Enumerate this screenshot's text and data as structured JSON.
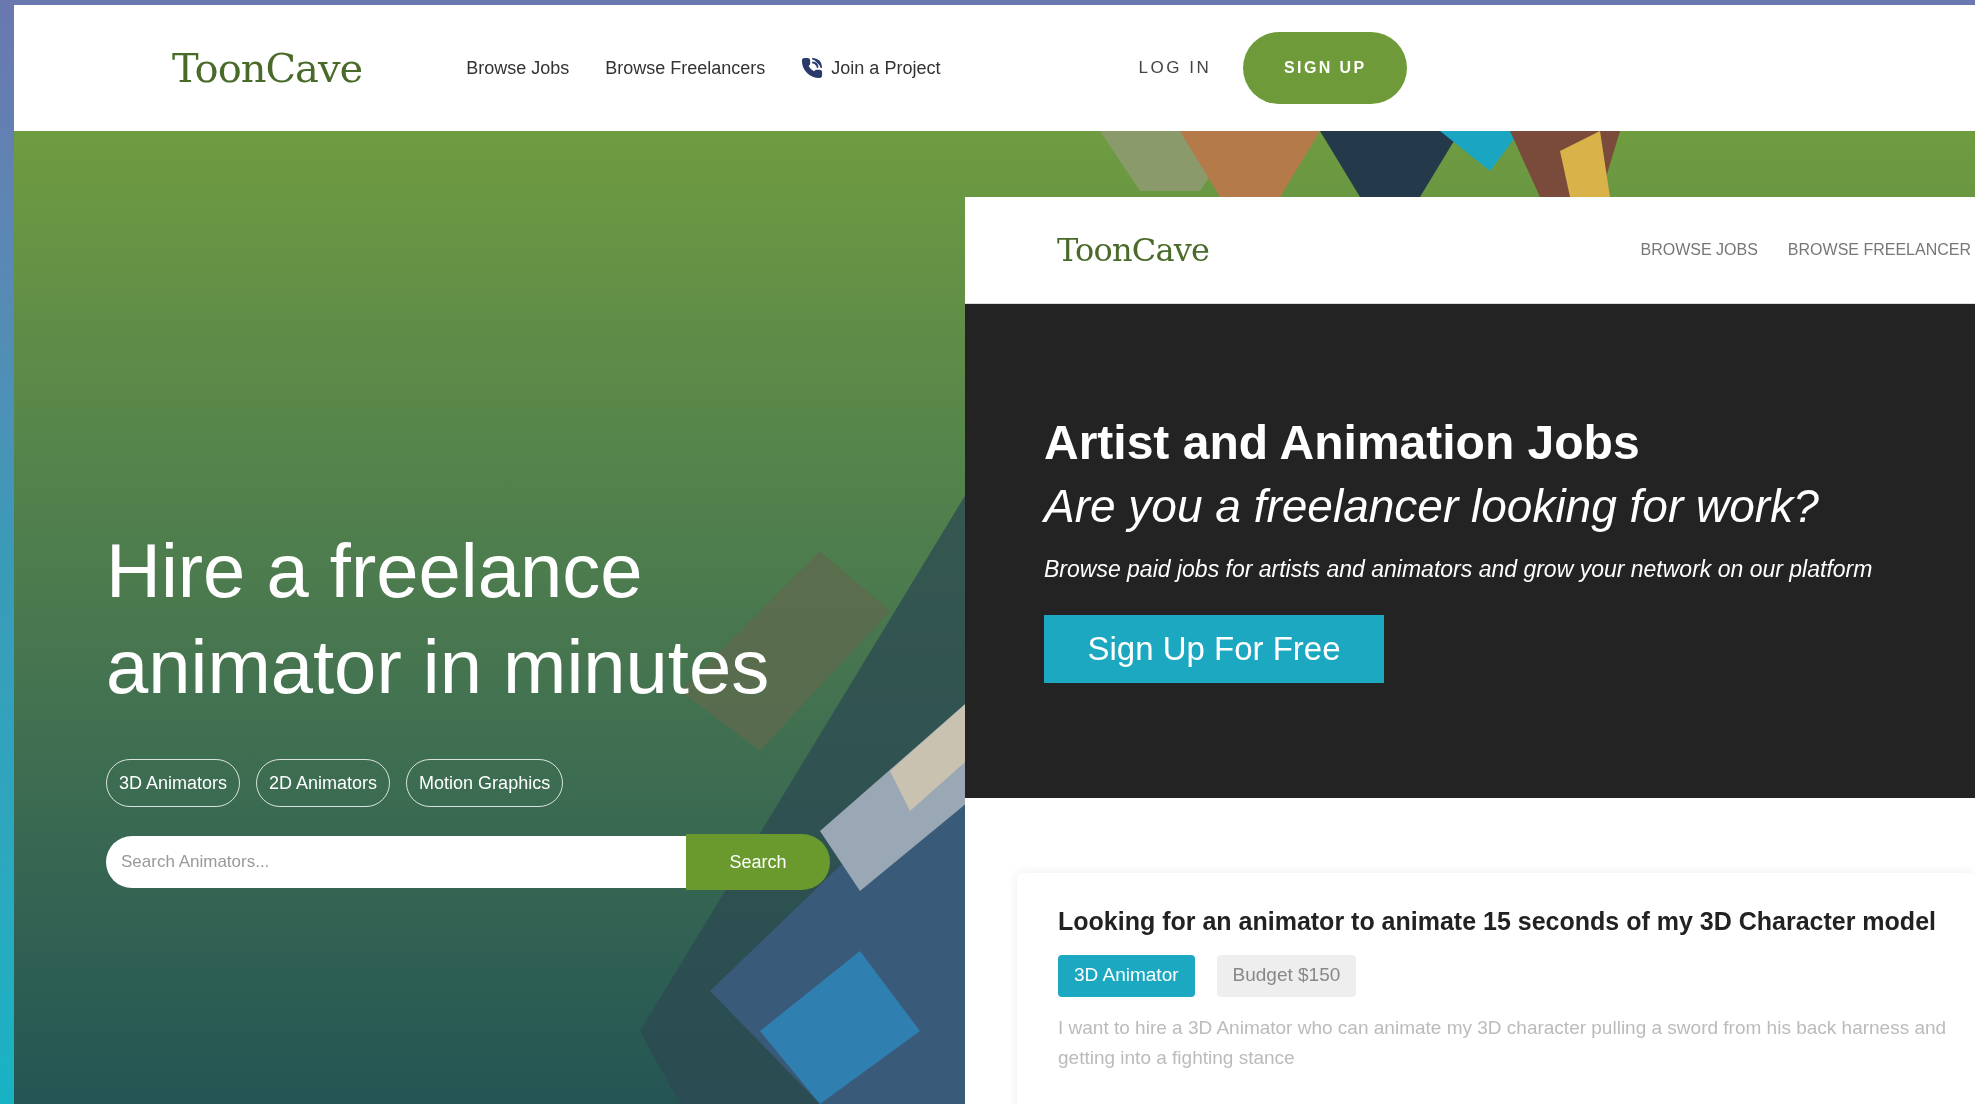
{
  "header": {
    "logo": "ToonCave",
    "nav": [
      "Browse Jobs",
      "Browse Freelancers",
      "Join a Project"
    ],
    "login": "LOG IN",
    "signup": "SIGN UP"
  },
  "hero": {
    "title_lines": [
      "Hire a freelance",
      "animator in minutes"
    ],
    "tags": [
      "3D Animators",
      "2D Animators",
      "Motion Graphics"
    ],
    "search": {
      "placeholder": "Search Animators...",
      "button": "Search"
    }
  },
  "inset": {
    "logo": "ToonCave",
    "nav": [
      "BROWSE JOBS",
      "BROWSE FREELANCER"
    ],
    "heading": "Artist and Animation Jobs",
    "subheading": "Are you a freelancer looking for work?",
    "text": "Browse paid jobs for artists and animators and grow your network on our platform",
    "button": "Sign Up For Free",
    "job": {
      "title": "Looking for an animator to animate 15 seconds of my 3D Character model",
      "tags": [
        {
          "label": "3D Animator",
          "kind": "category"
        },
        {
          "label": "Budget $150",
          "kind": "budget"
        }
      ],
      "description": "I want to hire a 3D Animator who can animate my 3D character pulling a sword from his back harness and getting into a fighting stance"
    }
  }
}
